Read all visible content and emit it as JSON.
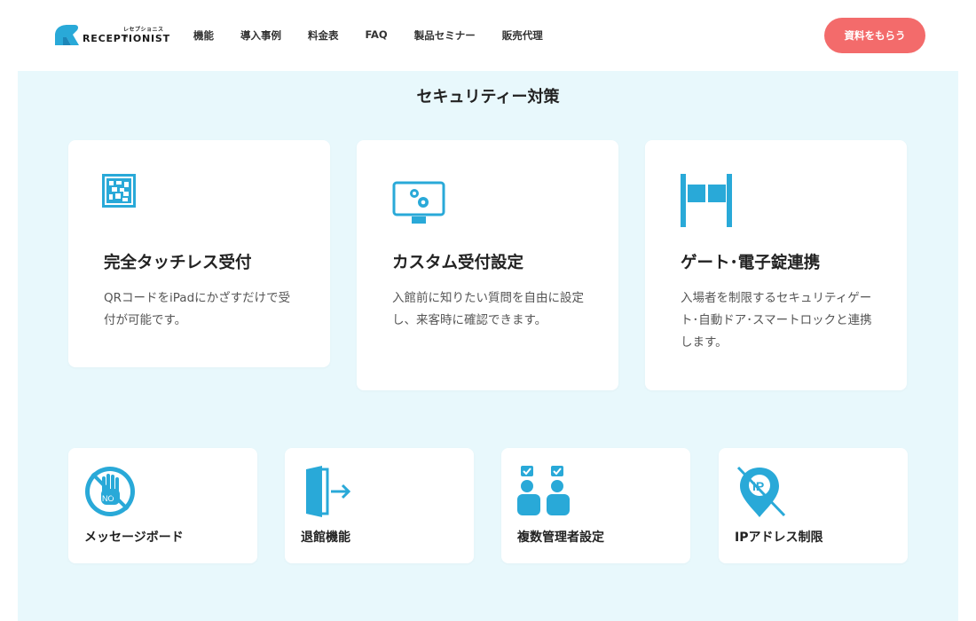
{
  "header": {
    "logo_kana": "レセプショニスト",
    "logo_word": "RECEPTIONIST",
    "nav": [
      "機能",
      "導入事例",
      "料金表",
      "FAQ",
      "製品セミナー",
      "販売代理"
    ],
    "cta_label": "資料をもらう"
  },
  "section": {
    "title": "セキュリティー対策"
  },
  "features": [
    {
      "icon": "qr-code-icon",
      "title": "完全タッチレス受付",
      "desc": "QRコードをiPadにかざすだけで受付が可能です。"
    },
    {
      "icon": "monitor-settings-icon",
      "title": "カスタム受付設定",
      "desc": "入館前に知りたい質問を自由に設定し、来客時に確認できます。"
    },
    {
      "icon": "security-gate-icon",
      "title": "ゲート･電子錠連携",
      "desc": "入場者を制限するセキュリティゲート･自動ドア･スマートロックと連携します。"
    }
  ],
  "small_features": [
    {
      "icon": "no-hand-icon",
      "label": "メッセージボード"
    },
    {
      "icon": "exit-door-icon",
      "label": "退館機能"
    },
    {
      "icon": "multiple-admins-icon",
      "label": "複数管理者設定"
    },
    {
      "icon": "ip-restriction-icon",
      "label": "IPアドレス制限"
    }
  ],
  "colors": {
    "accent": "#29a9d8",
    "cta": "#f36b6b",
    "band": "#e8f8fc"
  }
}
